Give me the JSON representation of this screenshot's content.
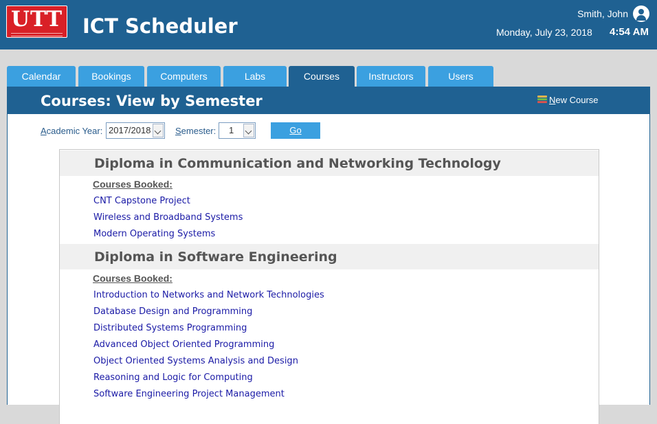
{
  "header": {
    "logo_text": "UTT",
    "app_title": "ICT Scheduler",
    "user_name": "Smith, John",
    "date": "Monday, July 23, 2018",
    "time": "4:54 AM"
  },
  "tabs": [
    {
      "label": "Calendar"
    },
    {
      "label": "Bookings"
    },
    {
      "label": "Computers"
    },
    {
      "label": "Labs"
    },
    {
      "label": "Courses",
      "active": true
    },
    {
      "label": "Instructors"
    },
    {
      "label": "Users"
    }
  ],
  "panel": {
    "title": "Courses: View by Semester",
    "new_course_first": "N",
    "new_course_rest": "ew Course"
  },
  "filters": {
    "academic_year_label_first": "A",
    "academic_year_label_rest": "cademic Year:",
    "academic_year_value": "2017/2018",
    "semester_label_first": "S",
    "semester_label_rest": "emester:",
    "semester_value": "1",
    "go_label": "Go"
  },
  "programs": [
    {
      "title": "Diploma in Communication and Networking Technology",
      "booked_label": "Courses Booked:",
      "courses": [
        "CNT Capstone Project",
        "Wireless and Broadband Systems",
        "Modern Operating Systems"
      ]
    },
    {
      "title": "Diploma in Software Engineering",
      "booked_label": "Courses Booked:",
      "courses": [
        "Introduction to Networks and Network Technologies",
        "Database Design and Programming",
        "Distributed Systems Programming",
        "Advanced Object Oriented Programming",
        "Object Oriented Systems Analysis and Design",
        "Reasoning and Logic for Computing",
        "Software Engineering Project Management"
      ]
    }
  ],
  "colors": {
    "header_bg": "#1f6192",
    "tab_bg": "#3ba0e0",
    "link": "#1a1aa6",
    "logo_red": "#d92027"
  }
}
